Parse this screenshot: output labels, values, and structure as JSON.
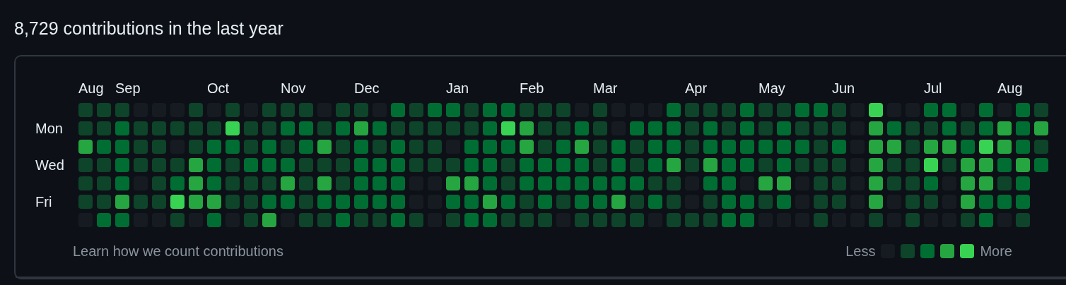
{
  "heading": "8,729 contributions in the last year",
  "rows": [
    {
      "days": [
        {
          "color": "#0e4429",
          "month": "Aug"
        },
        {
          "color": "#0e4429"
        },
        {
          "color": "#0e4429",
          "month": "Sep"
        },
        {
          "color": "#161b22"
        },
        {
          "color": "#161b22"
        },
        {
          "color": "#161b22"
        },
        {
          "color": "#0e4429"
        },
        {
          "color": "#161b22",
          "month": "Oct"
        },
        {
          "color": "#0e4429"
        },
        {
          "color": "#161b22"
        },
        {
          "color": "#0e4429"
        },
        {
          "color": "#0e4429",
          "month": "Nov"
        },
        {
          "color": "#0e4429"
        },
        {
          "color": "#161b22"
        },
        {
          "color": "#0e4429"
        },
        {
          "color": "#0e4429",
          "month": "Dec"
        },
        {
          "color": "#161b22"
        },
        {
          "color": "#006d32"
        },
        {
          "color": "#0e4429"
        },
        {
          "color": "#006d32"
        },
        {
          "color": "#006d32",
          "month": "Jan"
        },
        {
          "color": "#0e4429"
        },
        {
          "color": "#006d32"
        },
        {
          "color": "#006d32"
        },
        {
          "color": "#0e4429",
          "month": "Feb"
        },
        {
          "color": "#0e4429"
        },
        {
          "color": "#0e4429"
        },
        {
          "color": "#161b22"
        },
        {
          "color": "#0e4429",
          "month": "Mar"
        },
        {
          "color": "#161b22"
        },
        {
          "color": "#161b22"
        },
        {
          "color": "#161b22"
        },
        {
          "color": "#006d32"
        },
        {
          "color": "#0e4429",
          "month": "Apr"
        },
        {
          "color": "#0e4429"
        },
        {
          "color": "#0e4429"
        },
        {
          "color": "#006d32"
        },
        {
          "color": "#0e4429",
          "month": "May"
        },
        {
          "color": "#0e4429"
        },
        {
          "color": "#006d32"
        },
        {
          "color": "#006d32"
        },
        {
          "color": "#0e4429",
          "month": "Jun"
        },
        {
          "color": "#161b22"
        },
        {
          "color": "#39d353"
        },
        {
          "color": "#161b22"
        },
        {
          "color": "#161b22"
        },
        {
          "color": "#006d32",
          "month": "Jul"
        },
        {
          "color": "#006d32"
        },
        {
          "color": "#161b22"
        },
        {
          "color": "#006d32"
        },
        {
          "color": "#161b22",
          "month": "Aug"
        },
        {
          "color": "#006d32"
        },
        {
          "color": "#0e4429"
        }
      ]
    },
    {
      "label": "Mon",
      "days": [
        {
          "color": "#0e4429"
        },
        {
          "color": "#0e4429"
        },
        {
          "color": "#006d32"
        },
        {
          "color": "#0e4429"
        },
        {
          "color": "#0e4429"
        },
        {
          "color": "#0e4429"
        },
        {
          "color": "#0e4429"
        },
        {
          "color": "#0e4429"
        },
        {
          "color": "#39d353"
        },
        {
          "color": "#0e4429"
        },
        {
          "color": "#0e4429"
        },
        {
          "color": "#006d32"
        },
        {
          "color": "#006d32"
        },
        {
          "color": "#0e4429"
        },
        {
          "color": "#006d32"
        },
        {
          "color": "#26a641"
        },
        {
          "color": "#006d32"
        },
        {
          "color": "#0e4429"
        },
        {
          "color": "#0e4429"
        },
        {
          "color": "#0e4429"
        },
        {
          "color": "#0e4429"
        },
        {
          "color": "#0e4429"
        },
        {
          "color": "#006d32"
        },
        {
          "color": "#39d353"
        },
        {
          "color": "#26a641"
        },
        {
          "color": "#0e4429"
        },
        {
          "color": "#0e4429"
        },
        {
          "color": "#006d32"
        },
        {
          "color": "#0e4429"
        },
        {
          "color": "#161b22"
        },
        {
          "color": "#006d32"
        },
        {
          "color": "#006d32"
        },
        {
          "color": "#006d32"
        },
        {
          "color": "#0e4429"
        },
        {
          "color": "#006d32"
        },
        {
          "color": "#0e4429"
        },
        {
          "color": "#006d32"
        },
        {
          "color": "#0e4429"
        },
        {
          "color": "#006d32"
        },
        {
          "color": "#0e4429"
        },
        {
          "color": "#0e4429"
        },
        {
          "color": "#0e4429"
        },
        {
          "color": "#161b22"
        },
        {
          "color": "#26a641"
        },
        {
          "color": "#006d32"
        },
        {
          "color": "#0e4429"
        },
        {
          "color": "#0e4429"
        },
        {
          "color": "#006d32"
        },
        {
          "color": "#0e4429"
        },
        {
          "color": "#006d32"
        },
        {
          "color": "#26a641"
        },
        {
          "color": "#006d32"
        },
        {
          "color": "#26a641"
        }
      ]
    },
    {
      "days": [
        {
          "color": "#26a641"
        },
        {
          "color": "#006d32"
        },
        {
          "color": "#006d32"
        },
        {
          "color": "#0e4429"
        },
        {
          "color": "#0e4429"
        },
        {
          "color": "#161b22"
        },
        {
          "color": "#0e4429"
        },
        {
          "color": "#006d32"
        },
        {
          "color": "#006d32"
        },
        {
          "color": "#0e4429"
        },
        {
          "color": "#006d32"
        },
        {
          "color": "#0e4429"
        },
        {
          "color": "#006d32"
        },
        {
          "color": "#26a641"
        },
        {
          "color": "#0e4429"
        },
        {
          "color": "#006d32"
        },
        {
          "color": "#0e4429"
        },
        {
          "color": "#006d32"
        },
        {
          "color": "#0e4429"
        },
        {
          "color": "#0e4429"
        },
        {
          "color": "#161b22"
        },
        {
          "color": "#006d32"
        },
        {
          "color": "#006d32"
        },
        {
          "color": "#006d32"
        },
        {
          "color": "#26a641"
        },
        {
          "color": "#0e4429"
        },
        {
          "color": "#006d32"
        },
        {
          "color": "#26a641"
        },
        {
          "color": "#0e4429"
        },
        {
          "color": "#006d32"
        },
        {
          "color": "#0e4429"
        },
        {
          "color": "#006d32"
        },
        {
          "color": "#006d32"
        },
        {
          "color": "#0e4429"
        },
        {
          "color": "#006d32"
        },
        {
          "color": "#006d32"
        },
        {
          "color": "#006d32"
        },
        {
          "color": "#006d32"
        },
        {
          "color": "#006d32"
        },
        {
          "color": "#006d32"
        },
        {
          "color": "#0e4429"
        },
        {
          "color": "#006d32"
        },
        {
          "color": "#161b22"
        },
        {
          "color": "#26a641"
        },
        {
          "color": "#26a641"
        },
        {
          "color": "#0e4429"
        },
        {
          "color": "#26a641"
        },
        {
          "color": "#26a641"
        },
        {
          "color": "#006d32"
        },
        {
          "color": "#39d353"
        },
        {
          "color": "#26a641"
        },
        {
          "color": "#006d32"
        },
        {
          "color": "#0e4429"
        }
      ]
    },
    {
      "label": "Wed",
      "days": [
        {
          "color": "#0e4429"
        },
        {
          "color": "#0e4429"
        },
        {
          "color": "#006d32"
        },
        {
          "color": "#0e4429"
        },
        {
          "color": "#0e4429"
        },
        {
          "color": "#0e4429"
        },
        {
          "color": "#26a641"
        },
        {
          "color": "#006d32"
        },
        {
          "color": "#0e4429"
        },
        {
          "color": "#006d32"
        },
        {
          "color": "#006d32"
        },
        {
          "color": "#006d32"
        },
        {
          "color": "#0e4429"
        },
        {
          "color": "#0e4429"
        },
        {
          "color": "#0e4429"
        },
        {
          "color": "#006d32"
        },
        {
          "color": "#006d32"
        },
        {
          "color": "#006d32"
        },
        {
          "color": "#0e4429"
        },
        {
          "color": "#0e4429"
        },
        {
          "color": "#0e4429"
        },
        {
          "color": "#006d32"
        },
        {
          "color": "#006d32"
        },
        {
          "color": "#0e4429"
        },
        {
          "color": "#006d32"
        },
        {
          "color": "#006d32"
        },
        {
          "color": "#006d32"
        },
        {
          "color": "#006d32"
        },
        {
          "color": "#0e4429"
        },
        {
          "color": "#006d32"
        },
        {
          "color": "#0e4429"
        },
        {
          "color": "#006d32"
        },
        {
          "color": "#26a641"
        },
        {
          "color": "#0e4429"
        },
        {
          "color": "#26a641"
        },
        {
          "color": "#006d32"
        },
        {
          "color": "#006d32"
        },
        {
          "color": "#0e4429"
        },
        {
          "color": "#006d32"
        },
        {
          "color": "#0e4429"
        },
        {
          "color": "#0e4429"
        },
        {
          "color": "#0e4429"
        },
        {
          "color": "#161b22"
        },
        {
          "color": "#26a641"
        },
        {
          "color": "#0e4429"
        },
        {
          "color": "#0e4429"
        },
        {
          "color": "#39d353"
        },
        {
          "color": "#0e4429"
        },
        {
          "color": "#26a641"
        },
        {
          "color": "#26a641"
        },
        {
          "color": "#006d32"
        },
        {
          "color": "#26a641"
        },
        {
          "color": "#006d32"
        }
      ]
    },
    {
      "days": [
        {
          "color": "#0e4429"
        },
        {
          "color": "#0e4429"
        },
        {
          "color": "#006d32"
        },
        {
          "color": "#161b22"
        },
        {
          "color": "#0e4429"
        },
        {
          "color": "#006d32"
        },
        {
          "color": "#26a641"
        },
        {
          "color": "#006d32"
        },
        {
          "color": "#0e4429"
        },
        {
          "color": "#0e4429"
        },
        {
          "color": "#0e4429"
        },
        {
          "color": "#26a641"
        },
        {
          "color": "#0e4429"
        },
        {
          "color": "#26a641"
        },
        {
          "color": "#0e4429"
        },
        {
          "color": "#006d32"
        },
        {
          "color": "#006d32"
        },
        {
          "color": "#006d32"
        },
        {
          "color": "#161b22"
        },
        {
          "color": "#161b22"
        },
        {
          "color": "#26a641"
        },
        {
          "color": "#26a641"
        },
        {
          "color": "#006d32"
        },
        {
          "color": "#0e4429"
        },
        {
          "color": "#006d32"
        },
        {
          "color": "#006d32"
        },
        {
          "color": "#006d32"
        },
        {
          "color": "#006d32"
        },
        {
          "color": "#006d32"
        },
        {
          "color": "#006d32"
        },
        {
          "color": "#006d32"
        },
        {
          "color": "#0e4429"
        },
        {
          "color": "#0e4429"
        },
        {
          "color": "#161b22"
        },
        {
          "color": "#006d32"
        },
        {
          "color": "#006d32"
        },
        {
          "color": "#161b22"
        },
        {
          "color": "#26a641"
        },
        {
          "color": "#26a641"
        },
        {
          "color": "#161b22"
        },
        {
          "color": "#0e4429"
        },
        {
          "color": "#0e4429"
        },
        {
          "color": "#161b22"
        },
        {
          "color": "#26a641"
        },
        {
          "color": "#0e4429"
        },
        {
          "color": "#0e4429"
        },
        {
          "color": "#006d32"
        },
        {
          "color": "#161b22"
        },
        {
          "color": "#26a641"
        },
        {
          "color": "#26a641"
        },
        {
          "color": "#0e4429"
        },
        {
          "color": "#006d32"
        }
      ]
    },
    {
      "label": "Fri",
      "days": [
        {
          "color": "#0e4429"
        },
        {
          "color": "#0e4429"
        },
        {
          "color": "#26a641"
        },
        {
          "color": "#0e4429"
        },
        {
          "color": "#0e4429"
        },
        {
          "color": "#39d353"
        },
        {
          "color": "#26a641"
        },
        {
          "color": "#26a641"
        },
        {
          "color": "#0e4429"
        },
        {
          "color": "#0e4429"
        },
        {
          "color": "#006d32"
        },
        {
          "color": "#006d32"
        },
        {
          "color": "#0e4429"
        },
        {
          "color": "#006d32"
        },
        {
          "color": "#006d32"
        },
        {
          "color": "#006d32"
        },
        {
          "color": "#006d32"
        },
        {
          "color": "#006d32"
        },
        {
          "color": "#161b22"
        },
        {
          "color": "#161b22"
        },
        {
          "color": "#006d32"
        },
        {
          "color": "#006d32"
        },
        {
          "color": "#26a641"
        },
        {
          "color": "#006d32"
        },
        {
          "color": "#0e4429"
        },
        {
          "color": "#006d32"
        },
        {
          "color": "#0e4429"
        },
        {
          "color": "#006d32"
        },
        {
          "color": "#006d32"
        },
        {
          "color": "#26a641"
        },
        {
          "color": "#0e4429"
        },
        {
          "color": "#006d32"
        },
        {
          "color": "#0e4429"
        },
        {
          "color": "#161b22"
        },
        {
          "color": "#0e4429"
        },
        {
          "color": "#006d32"
        },
        {
          "color": "#006d32"
        },
        {
          "color": "#0e4429"
        },
        {
          "color": "#006d32"
        },
        {
          "color": "#161b22"
        },
        {
          "color": "#0e4429"
        },
        {
          "color": "#0e4429"
        },
        {
          "color": "#161b22"
        },
        {
          "color": "#26a641"
        },
        {
          "color": "#161b22"
        },
        {
          "color": "#0e4429"
        },
        {
          "color": "#0e4429"
        },
        {
          "color": "#161b22"
        },
        {
          "color": "#26a641"
        },
        {
          "color": "#006d32"
        },
        {
          "color": "#006d32"
        },
        {
          "color": "#006d32"
        }
      ]
    },
    {
      "days": [
        {
          "color": "#161b22"
        },
        {
          "color": "#006d32"
        },
        {
          "color": "#006d32"
        },
        {
          "color": "#161b22"
        },
        {
          "color": "#161b22"
        },
        {
          "color": "#0e4429"
        },
        {
          "color": "#161b22"
        },
        {
          "color": "#006d32"
        },
        {
          "color": "#161b22"
        },
        {
          "color": "#0e4429"
        },
        {
          "color": "#26a641"
        },
        {
          "color": "#161b22"
        },
        {
          "color": "#0e4429"
        },
        {
          "color": "#0e4429"
        },
        {
          "color": "#006d32"
        },
        {
          "color": "#0e4429"
        },
        {
          "color": "#0e4429"
        },
        {
          "color": "#006d32"
        },
        {
          "color": "#0e4429"
        },
        {
          "color": "#161b22"
        },
        {
          "color": "#0e4429"
        },
        {
          "color": "#006d32"
        },
        {
          "color": "#006d32"
        },
        {
          "color": "#0e4429"
        },
        {
          "color": "#0e4429"
        },
        {
          "color": "#0e4429"
        },
        {
          "color": "#161b22"
        },
        {
          "color": "#0e4429"
        },
        {
          "color": "#0e4429"
        },
        {
          "color": "#0e4429"
        },
        {
          "color": "#0e4429"
        },
        {
          "color": "#161b22"
        },
        {
          "color": "#0e4429"
        },
        {
          "color": "#0e4429"
        },
        {
          "color": "#0e4429"
        },
        {
          "color": "#006d32"
        },
        {
          "color": "#006d32"
        },
        {
          "color": "#161b22"
        },
        {
          "color": "#161b22"
        },
        {
          "color": "#161b22"
        },
        {
          "color": "#0e4429"
        },
        {
          "color": "#161b22"
        },
        {
          "color": "#161b22"
        },
        {
          "color": "#0e4429"
        },
        {
          "color": "#161b22"
        },
        {
          "color": "#0e4429"
        },
        {
          "color": "#161b22"
        },
        {
          "color": "#161b22"
        },
        {
          "color": "#0e4429"
        },
        {
          "color": "#006d32"
        },
        {
          "color": "#161b22"
        },
        {
          "color": "#0e4429"
        }
      ]
    }
  ],
  "footer": {
    "link": "Learn how we count contributions",
    "less": "Less",
    "more": "More",
    "swatches": [
      {
        "color": "#161b22"
      },
      {
        "color": "#0e4429"
      },
      {
        "color": "#006d32"
      },
      {
        "color": "#26a641"
      },
      {
        "color": "#39d353"
      }
    ]
  }
}
